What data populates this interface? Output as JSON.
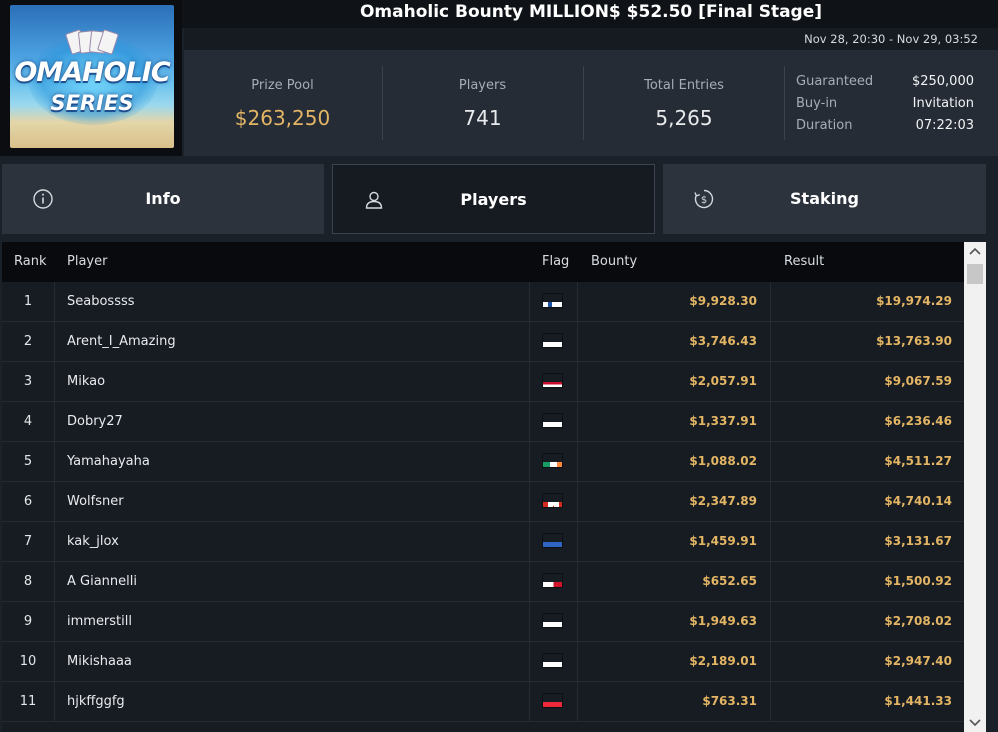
{
  "header": {
    "title": "Omaholic Bounty MILLION$ $52.50 [Final Stage]",
    "dates": "Nov 28, 20:30 - Nov 29, 03:52"
  },
  "logo": {
    "line1": "OMAHOLIC",
    "line2": "SERIES"
  },
  "stats": {
    "prize_pool_label": "Prize Pool",
    "prize_pool": "$263,250",
    "players_label": "Players",
    "players": "741",
    "entries_label": "Total Entries",
    "entries": "5,265",
    "guaranteed_label": "Guaranteed",
    "guaranteed": "$250,000",
    "buyin_label": "Buy-in",
    "buyin": "Invitation",
    "duration_label": "Duration",
    "duration": "07:22:03"
  },
  "tabs": {
    "info": "Info",
    "players": "Players",
    "staking": "Staking"
  },
  "table": {
    "columns": {
      "rank": "Rank",
      "player": "Player",
      "flag": "Flag",
      "bounty": "Bounty",
      "result": "Result"
    },
    "rows": [
      {
        "rank": "1",
        "player": "Seabossss",
        "flag": "finland-flag-icon",
        "bounty": "$9,928.30",
        "result": "$19,974.29"
      },
      {
        "rank": "2",
        "player": "Arent_I_Amazing",
        "flag": "russia-flag-icon",
        "bounty": "$3,746.43",
        "result": "$13,763.90"
      },
      {
        "rank": "3",
        "player": "Mikao",
        "flag": "thailand-flag-icon",
        "bounty": "$2,057.91",
        "result": "$9,067.59"
      },
      {
        "rank": "4",
        "player": "Dobry27",
        "flag": "poland-flag-icon",
        "bounty": "$1,337.91",
        "result": "$6,236.46"
      },
      {
        "rank": "5",
        "player": "Yamahayaha",
        "flag": "ireland-flag-icon",
        "bounty": "$1,088.02",
        "result": "$4,511.27"
      },
      {
        "rank": "6",
        "player": "Wolfsner",
        "flag": "canada-flag-icon",
        "bounty": "$2,347.89",
        "result": "$4,740.14"
      },
      {
        "rank": "7",
        "player": "kak_jlox",
        "flag": "ukraine-flag-icon",
        "bounty": "$1,459.91",
        "result": "$3,131.67"
      },
      {
        "rank": "8",
        "player": "A Giannelli",
        "flag": "malta-flag-icon",
        "bounty": "$652.65",
        "result": "$1,500.92"
      },
      {
        "rank": "9",
        "player": "immerstill",
        "flag": "russia-flag-icon",
        "bounty": "$1,949.63",
        "result": "$2,708.02"
      },
      {
        "rank": "10",
        "player": "Mikishaaa",
        "flag": "russia-flag-icon",
        "bounty": "$2,189.01",
        "result": "$2,947.40"
      },
      {
        "rank": "11",
        "player": "hjkffggfg",
        "flag": "austria-flag-icon",
        "bounty": "$763.31",
        "result": "$1,441.33"
      }
    ]
  },
  "colors": {
    "gold": "#e3b564",
    "panel": "#252c36",
    "tab_active": "#161b22"
  }
}
